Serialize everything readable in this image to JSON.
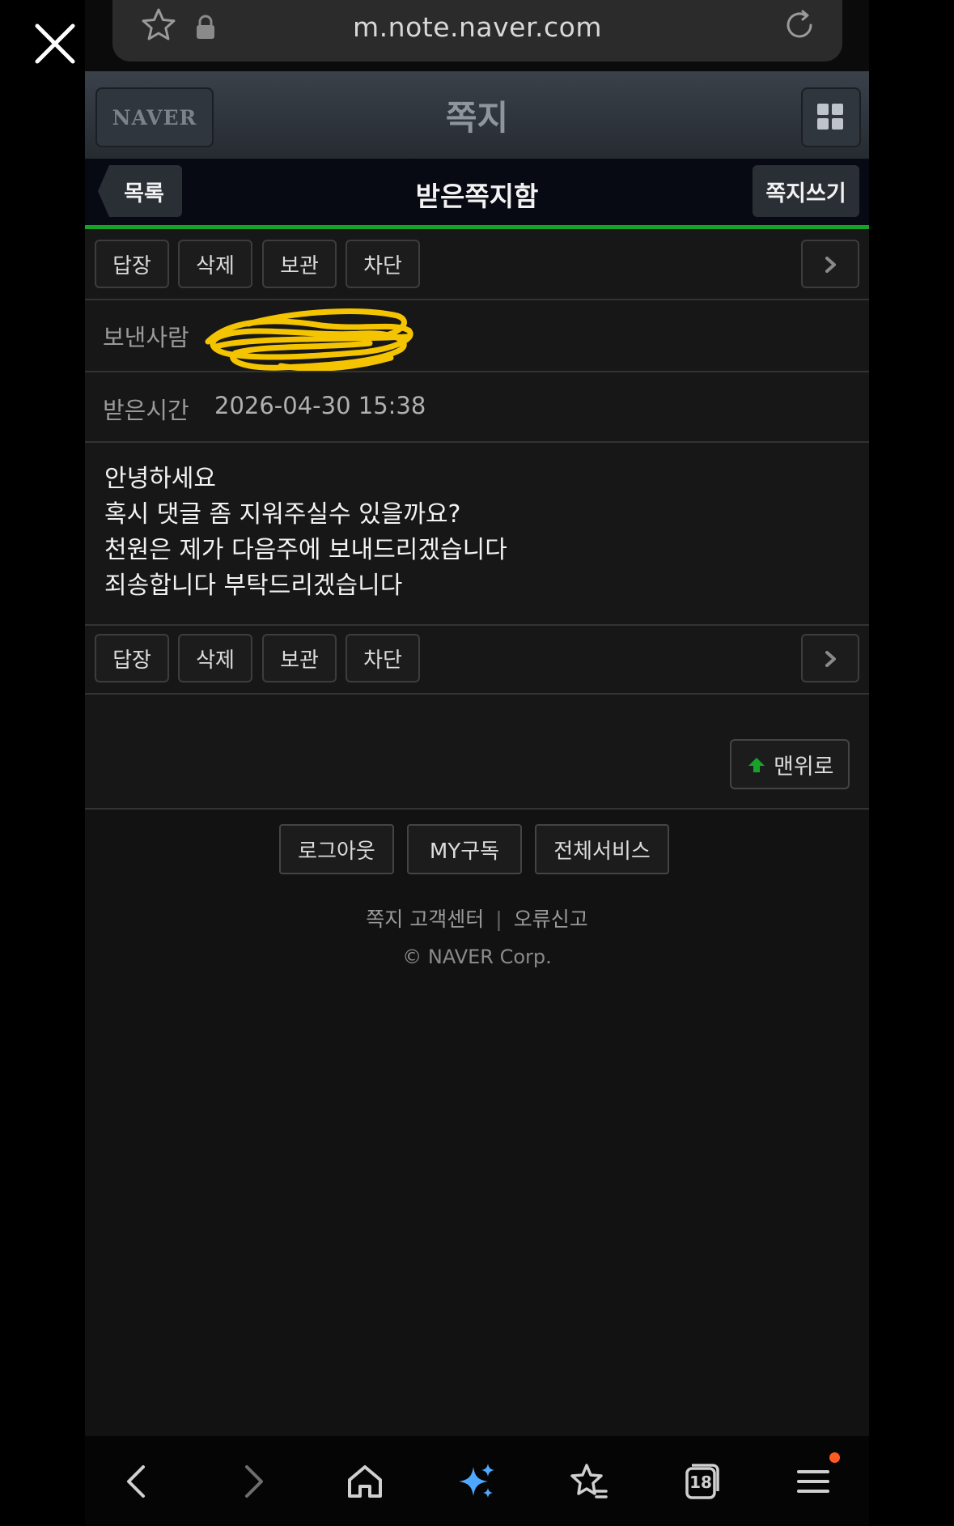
{
  "browser": {
    "url": "m.note.naver.com",
    "tab_count": "18"
  },
  "header": {
    "logo": "NAVER",
    "title": "쪽지"
  },
  "subheader": {
    "list_label": "목록",
    "title": "받은쪽지함",
    "write_label": "쪽지쓰기"
  },
  "actions": {
    "reply": "답장",
    "delete": "삭제",
    "save": "보관",
    "block": "차단"
  },
  "message": {
    "sender_label": "보낸사람",
    "time_label": "받은시간",
    "time_value": "2026-04-30 15:38",
    "body": [
      "안녕하세요",
      "혹시 댓글 좀 지워주실수 있을까요?",
      "천원은 제가 다음주에 보내드리겠습니다",
      "죄송합니다 부탁드리겠습니다"
    ]
  },
  "top_button": "맨위로",
  "footer": {
    "buttons": [
      "로그아웃",
      "MY구독",
      "전체서비스"
    ],
    "link_support": "쪽지 고객센터",
    "link_separator": "|",
    "link_report": "오류신고",
    "copyright": "© NAVER Corp."
  },
  "colors": {
    "accent_green": "#15a325",
    "notification_dot": "#ff5a1f",
    "redaction_yellow": "#f5c400"
  }
}
